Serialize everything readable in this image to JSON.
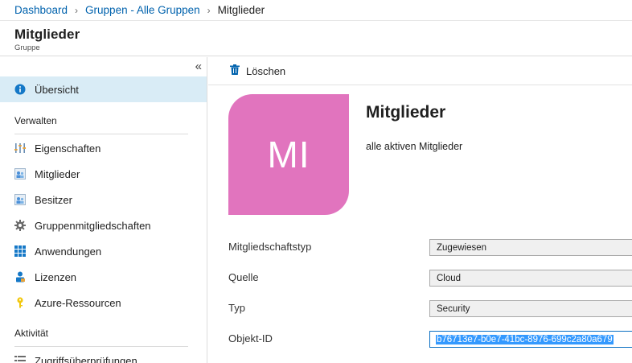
{
  "breadcrumb": {
    "items": [
      "Dashboard",
      "Gruppen - Alle Gruppen"
    ],
    "current": "Mitglieder",
    "separator": "›"
  },
  "header": {
    "title": "Mitglieder",
    "subtitle": "Gruppe"
  },
  "sidebar": {
    "collapse_label": "«",
    "top_item": {
      "label": "Übersicht",
      "icon": "info-icon"
    },
    "sections": [
      {
        "title": "Verwalten"
      },
      {
        "title": "Aktivität"
      }
    ],
    "manage_items": [
      {
        "label": "Eigenschaften",
        "icon": "properties-icon"
      },
      {
        "label": "Mitglieder",
        "icon": "members-icon"
      },
      {
        "label": "Besitzer",
        "icon": "owners-icon"
      },
      {
        "label": "Gruppenmitgliedschaften",
        "icon": "gear-icon"
      },
      {
        "label": "Anwendungen",
        "icon": "grid-icon"
      },
      {
        "label": "Lizenzen",
        "icon": "license-icon"
      },
      {
        "label": "Azure-Ressourcen",
        "icon": "key-icon"
      }
    ],
    "activity_items": [
      {
        "label": "Zugriffsüberprüfungen",
        "icon": "list-icon"
      }
    ]
  },
  "toolbar": {
    "delete_label": "Löschen",
    "delete_icon": "trash-icon"
  },
  "group": {
    "initials": "MI",
    "name": "Mitglieder",
    "description": "alle aktiven Mitglieder",
    "avatar_color": "#e174be"
  },
  "properties": [
    {
      "label": "Mitgliedschaftstyp",
      "value": "Zugewiesen"
    },
    {
      "label": "Quelle",
      "value": "Cloud"
    },
    {
      "label": "Typ",
      "value": "Security"
    },
    {
      "label": "Objekt-ID",
      "value": "b76713e7-b0e7-41bc-8976-699c2a80a679"
    }
  ],
  "colors": {
    "accent": "#0062ad",
    "active_bg": "#d9ecf6",
    "selection": "#3399ff"
  }
}
